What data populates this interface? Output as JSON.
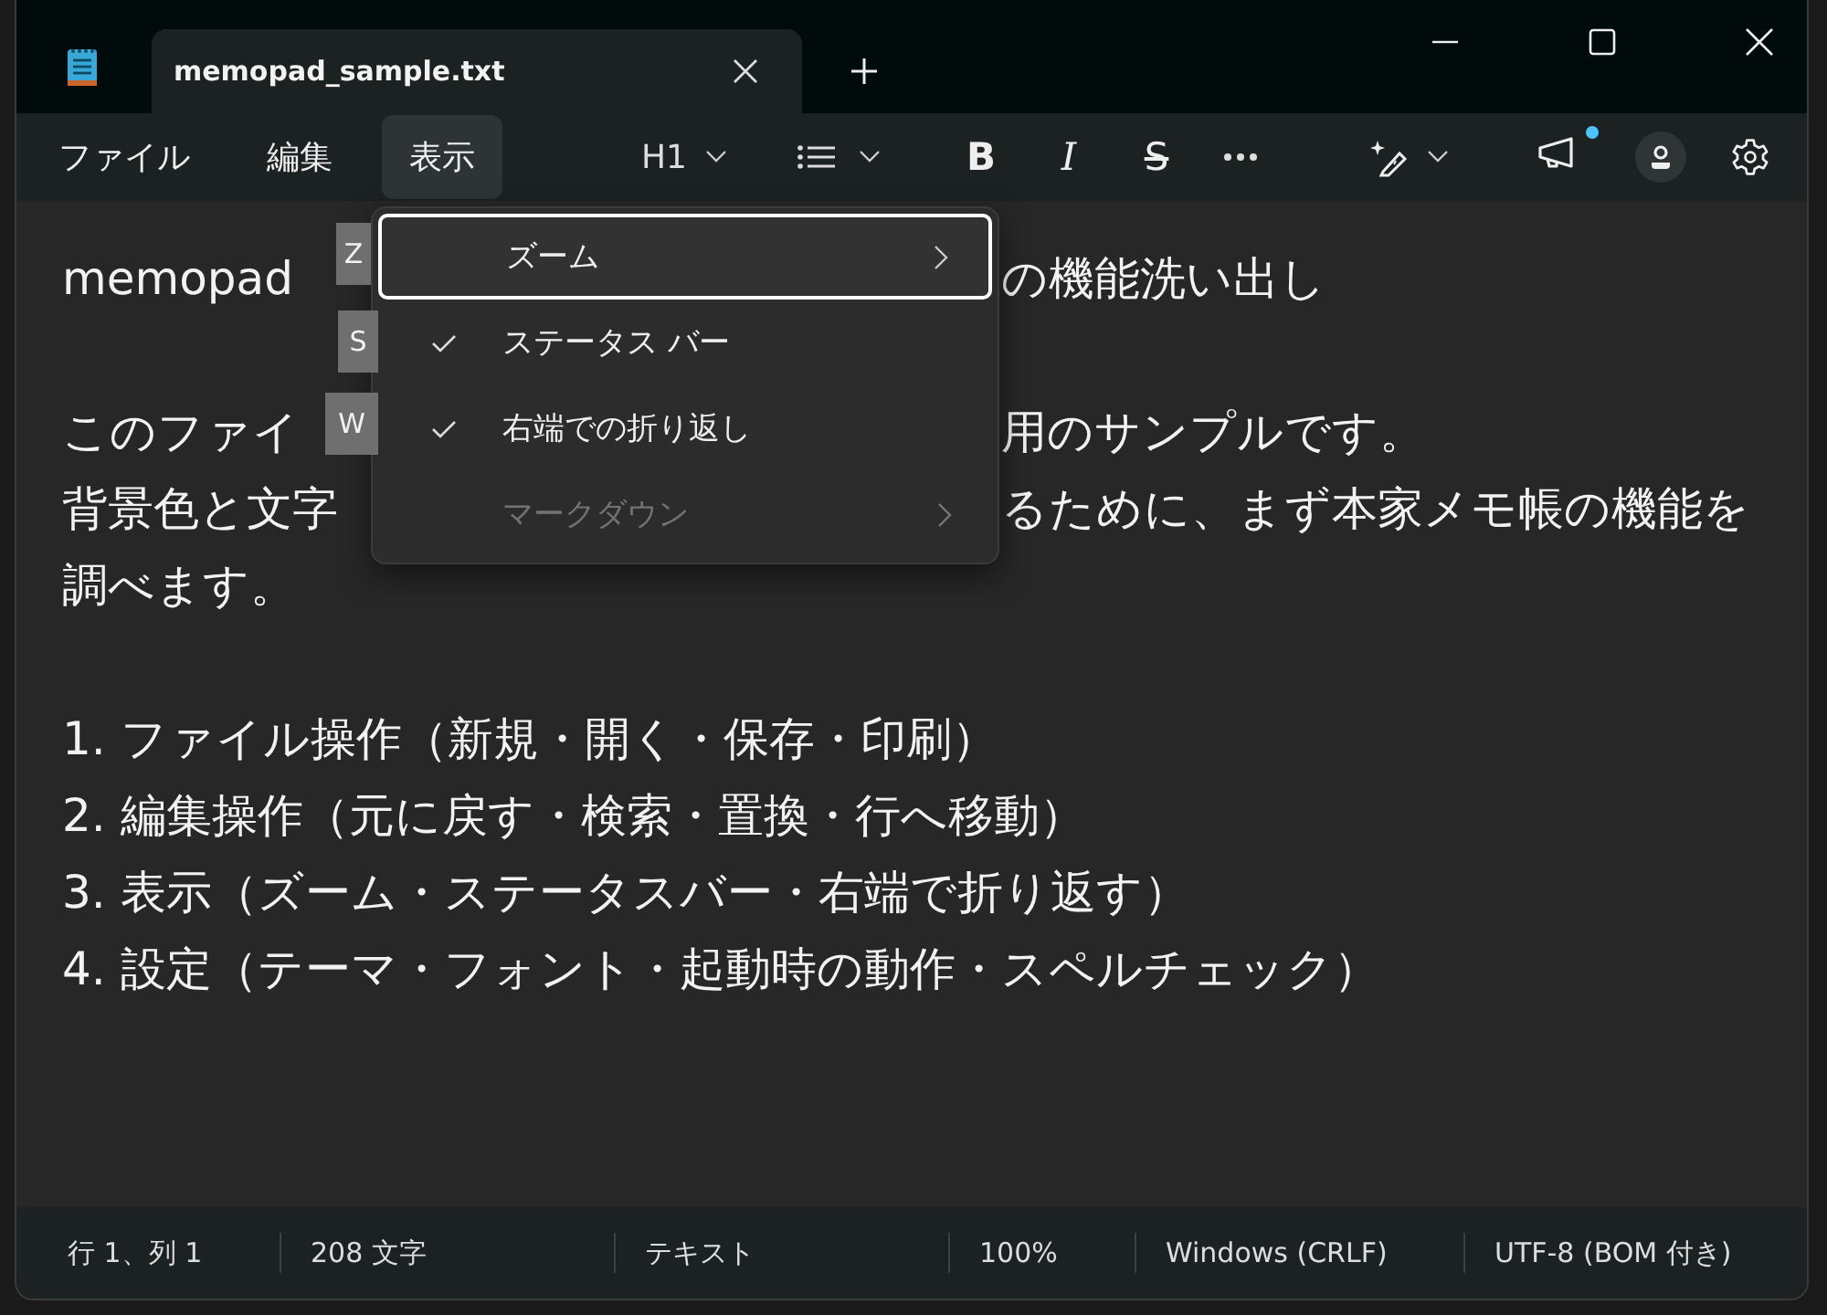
{
  "tab": {
    "title": "memopad_sample.txt"
  },
  "menubar": [
    {
      "label": "ファイル",
      "selected": false
    },
    {
      "label": "編集",
      "selected": false
    },
    {
      "label": "表示",
      "selected": true
    }
  ],
  "toolbar": {
    "heading": "H1",
    "bold": "B",
    "italic": "I",
    "strike": "S",
    "notification": true
  },
  "document": {
    "paragraphs": [
      {
        "lines": [
          {
            "text": "memopad",
            "after": "の機能洗い出し"
          }
        ]
      },
      {
        "lines": [
          {
            "text": "このファイ",
            "after": "用のサンプルです。"
          },
          {
            "text": "背景色と文字",
            "after": "るために、まず本家メモ帳の機能を"
          },
          {
            "text": "調べます。"
          }
        ]
      },
      {
        "lines": [
          {
            "text": "1. ファイル操作（新規・開く・保存・印刷）"
          },
          {
            "text": "2. 編集操作（元に戻す・検索・置換・行へ移動）"
          },
          {
            "text": "3. 表示（ズーム・ステータスバー・右端で折り返す）"
          },
          {
            "text": "4. 設定（テーマ・フォント・起動時の動作・スペルチェック）"
          }
        ]
      }
    ]
  },
  "view_menu": {
    "items": [
      {
        "label": "ズーム",
        "kind": "submenu",
        "access_key": "Z",
        "checked": false,
        "disabled": false,
        "selected": true
      },
      {
        "label": "ステータス バー",
        "kind": "toggle",
        "access_key": "S",
        "checked": true,
        "disabled": false,
        "selected": false
      },
      {
        "label": "右端での折り返し",
        "kind": "toggle",
        "access_key": "W",
        "checked": true,
        "disabled": false,
        "selected": false
      },
      {
        "label": "マークダウン",
        "kind": "submenu",
        "checked": false,
        "disabled": true,
        "selected": false
      }
    ]
  },
  "status_bar": [
    "行 1、列 1",
    "208 文字",
    "テキスト",
    "100%",
    "Windows (CRLF)",
    "UTF-8 (BOM 付き)"
  ]
}
